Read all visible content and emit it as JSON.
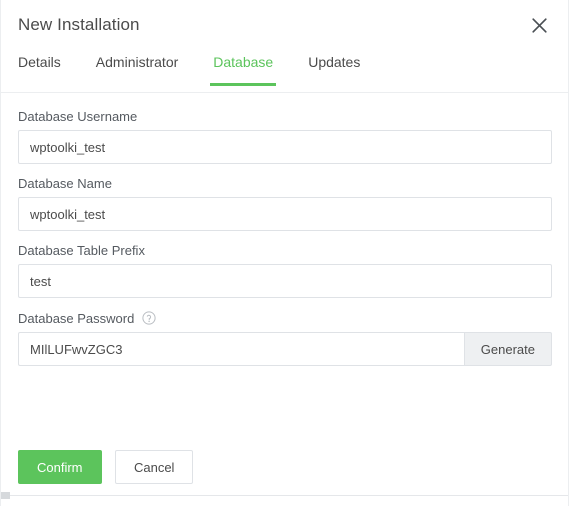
{
  "dialog": {
    "title": "New Installation",
    "close_icon": "close-icon"
  },
  "tabs": [
    {
      "label": "Details",
      "active": false
    },
    {
      "label": "Administrator",
      "active": false
    },
    {
      "label": "Database",
      "active": true
    },
    {
      "label": "Updates",
      "active": false
    }
  ],
  "form": {
    "username": {
      "label": "Database Username",
      "value": "wptoolki_test",
      "placeholder": ""
    },
    "dbname": {
      "label": "Database Name",
      "value": "wptoolki_test",
      "placeholder": ""
    },
    "prefix": {
      "label": "Database Table Prefix",
      "value": "test",
      "placeholder": ""
    },
    "password": {
      "label": "Database Password",
      "help_icon": "help-circle-icon",
      "value": "MIlLUFwvZGC3",
      "placeholder": "",
      "generate_label": "Generate"
    }
  },
  "footer": {
    "confirm_label": "Confirm",
    "cancel_label": "Cancel"
  },
  "colors": {
    "accent_green": "#5cc45c",
    "text": "#4b4b4b",
    "label": "#555a60",
    "border": "#dfe2e6",
    "button_gray": "#eef0f2"
  }
}
